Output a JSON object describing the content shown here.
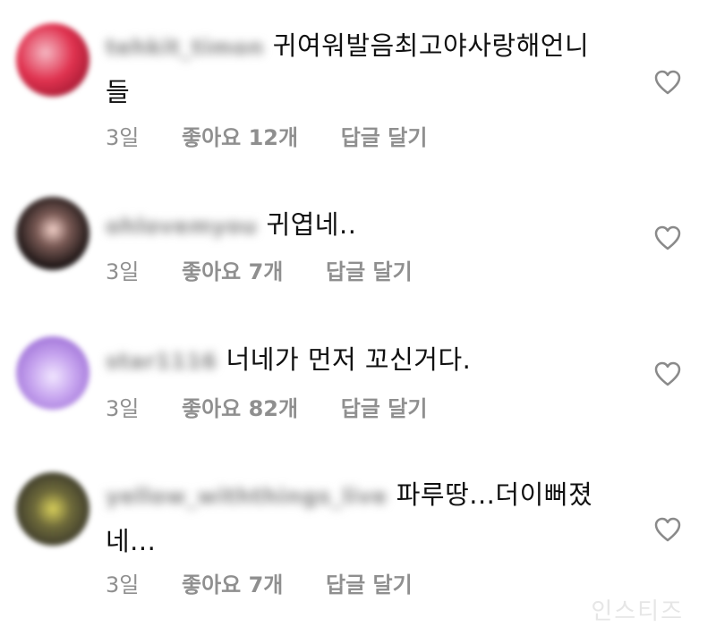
{
  "comments": [
    {
      "username": "tehkit_timon",
      "text": "귀여워발음최고야사랑해언니들",
      "time": "3일",
      "likes": "좋아요 12개",
      "reply": "답글 달기"
    },
    {
      "username": "ohlovemyou",
      "text": "귀엽네..",
      "time": "3일",
      "likes": "좋아요 7개",
      "reply": "답글 달기"
    },
    {
      "username": "star1116",
      "text": "너네가 먼저 꼬신거다.",
      "time": "3일",
      "likes": "좋아요 82개",
      "reply": "답글 달기"
    },
    {
      "username": "yellow_withthings_live",
      "text": "파루땅...더이뻐졌네...",
      "time": "3일",
      "likes": "좋아요 7개",
      "reply": "답글 달기"
    }
  ],
  "icons": {
    "like": "heart-outline-icon"
  },
  "watermark": "인스티즈",
  "colors": {
    "meta_text": "#8f8f8f",
    "body_text": "#111111",
    "heart_stroke": "#8a8a8a"
  }
}
